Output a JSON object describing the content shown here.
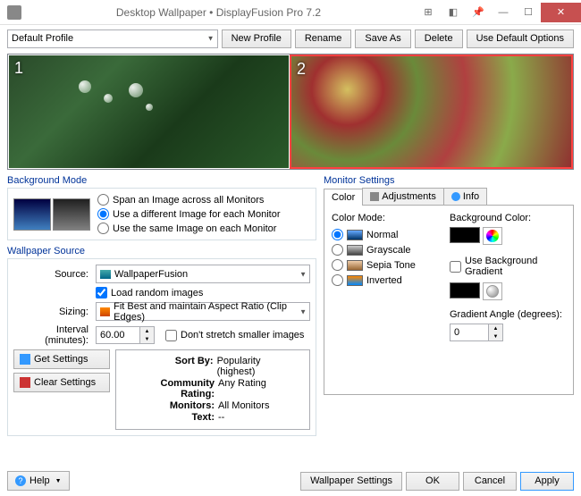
{
  "window": {
    "title": "Desktop Wallpaper • DisplayFusion Pro 7.2"
  },
  "toolbar": {
    "profile": "Default Profile",
    "new_profile": "New Profile",
    "rename": "Rename",
    "save_as": "Save As",
    "delete": "Delete",
    "use_defaults": "Use Default Options"
  },
  "monitors": {
    "m1": "1",
    "m2": "2"
  },
  "bg_mode": {
    "label": "Background Mode",
    "span": "Span an Image across all Monitors",
    "diff": "Use a different Image for each Monitor",
    "same": "Use the same Image on each Monitor"
  },
  "source": {
    "label": "Wallpaper Source",
    "source_lbl": "Source:",
    "source_val": "WallpaperFusion",
    "load_random": "Load random images",
    "sizing_lbl": "Sizing:",
    "sizing_val": "Fit Best and maintain Aspect Ratio (Clip Edges)",
    "interval_lbl": "Interval (minutes):",
    "interval_val": "60.00",
    "dont_stretch": "Don't stretch smaller images",
    "get_settings": "Get Settings",
    "clear_settings": "Clear Settings",
    "summary": {
      "sort_k": "Sort By:",
      "sort_v": "Popularity (highest)",
      "rating_k": "Community Rating:",
      "rating_v": "Any Rating",
      "monitors_k": "Monitors:",
      "monitors_v": "All Monitors",
      "text_k": "Text:",
      "text_v": "--"
    }
  },
  "monitor_settings": {
    "label": "Monitor Settings",
    "tab_color": "Color",
    "tab_adjust": "Adjustments",
    "tab_info": "Info",
    "color_mode": "Color Mode:",
    "normal": "Normal",
    "grayscale": "Grayscale",
    "sepia": "Sepia Tone",
    "inverted": "Inverted",
    "bgcolor": "Background Color:",
    "use_gradient": "Use Background Gradient",
    "grad_angle": "Gradient Angle (degrees):",
    "grad_val": "0"
  },
  "bottom": {
    "help": "Help",
    "wallpaper_settings": "Wallpaper Settings",
    "ok": "OK",
    "cancel": "Cancel",
    "apply": "Apply"
  }
}
